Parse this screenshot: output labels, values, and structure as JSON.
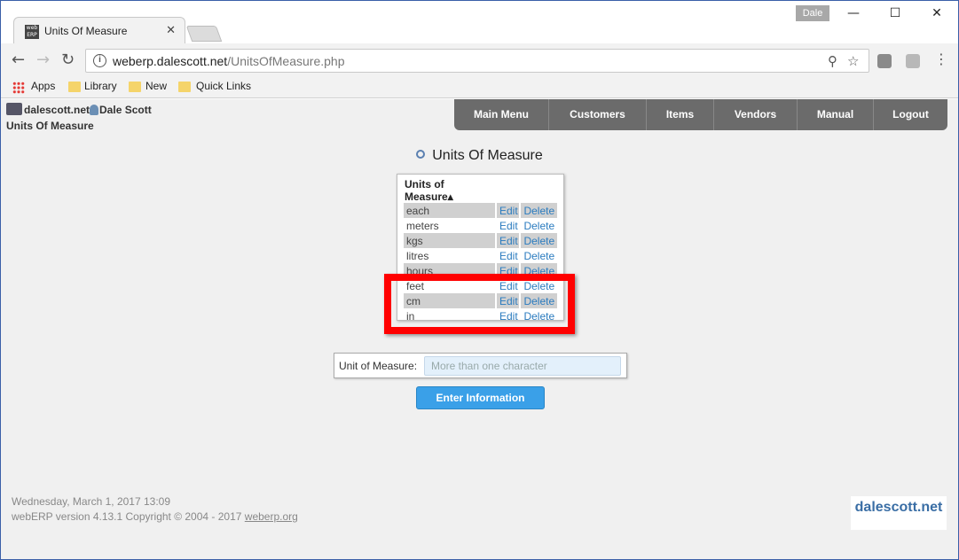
{
  "browser": {
    "tab_title": "Units Of Measure",
    "tab_favicon_text": "web ERP",
    "profile_name": "Dale",
    "url_host": "weberp.dalescott.net",
    "url_path": "/UnitsOfMeasure.php",
    "bookmarks": [
      "Apps",
      "Library",
      "New",
      "Quick Links"
    ]
  },
  "header": {
    "site": "dalescott.net",
    "user": "Dale Scott",
    "page_title": "Units Of Measure"
  },
  "main_menu": [
    "Main Menu",
    "Customers",
    "Items",
    "Vendors",
    "Manual",
    "Logout"
  ],
  "heading": "Units Of Measure",
  "uom_table": {
    "column_header": "Units of Measure",
    "edit_label": "Edit",
    "delete_label": "Delete",
    "rows": [
      "each",
      "meters",
      "kgs",
      "litres",
      "hours",
      "feet",
      "cm",
      "in"
    ]
  },
  "form": {
    "label": "Unit of Measure:",
    "placeholder": "More than one character",
    "submit_label": "Enter Information"
  },
  "footer": {
    "datetime": "Wednesday, March 1, 2017 13:09",
    "version": "webERP version 4.13.1 Copyright © 2004 - 2017",
    "link": "weberp.org"
  },
  "brand": "dalescott.net",
  "colors": {
    "highlight": "#ff0000",
    "button": "#3aa0e8",
    "nav": "#6b6b6b"
  }
}
